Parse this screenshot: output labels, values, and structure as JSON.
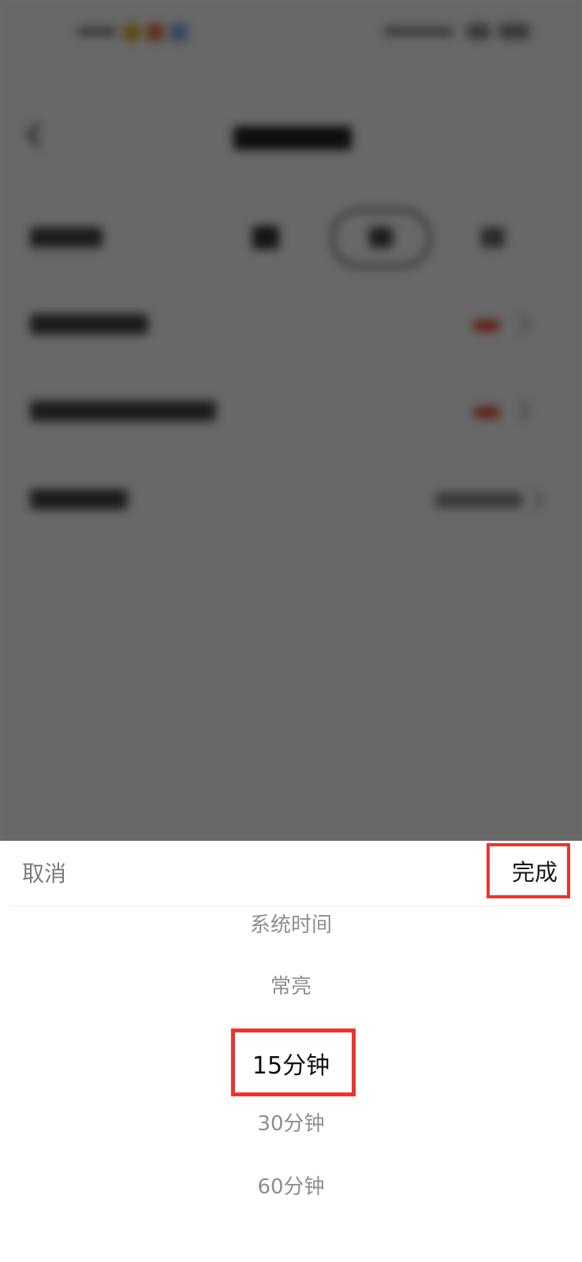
{
  "sheet": {
    "cancel_label": "取消",
    "done_label": "完成",
    "options": [
      {
        "label": "系统时间",
        "selected": false
      },
      {
        "label": "常亮",
        "selected": false
      },
      {
        "label": "15分钟",
        "selected": true
      },
      {
        "label": "30分钟",
        "selected": false
      },
      {
        "label": "60分钟",
        "selected": false
      }
    ]
  },
  "colors": {
    "highlight": "#e8362e",
    "dim_overlay": "rgba(0,0,0,0.58)",
    "muted_text": "#8e8e8e",
    "accent_mark": "#e0442e"
  }
}
